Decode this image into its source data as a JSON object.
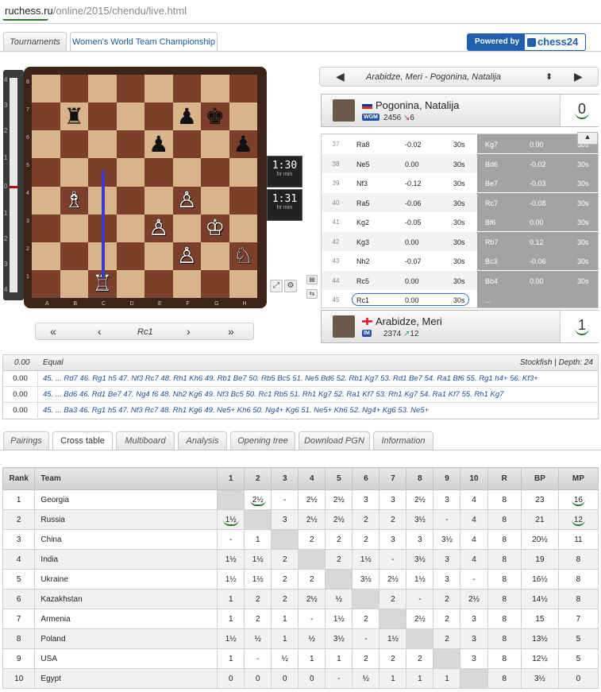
{
  "url": {
    "host": "ruchess.ru",
    "path": "/online/2015/chendu/live.html"
  },
  "top_tabs": [
    "Tournaments",
    "Women's World Team Championship"
  ],
  "powered": {
    "label": "Powered by",
    "brand": "chess24"
  },
  "eval_ticks": [
    "4",
    "3",
    "2",
    "1",
    "0",
    "1",
    "2",
    "3",
    "4"
  ],
  "board": {
    "ranks": [
      "8",
      "7",
      "6",
      "5",
      "4",
      "3",
      "2",
      "1"
    ],
    "files": [
      "A",
      "B",
      "C",
      "D",
      "E",
      "F",
      "G",
      "H"
    ],
    "squares": [
      [
        "",
        "",
        "",
        "",
        "",
        "",
        "",
        ""
      ],
      [
        "",
        "♜",
        "",
        "",
        "",
        "♟",
        "♚",
        ""
      ],
      [
        "",
        "",
        "",
        "",
        "♟",
        "",
        "",
        "♟"
      ],
      [
        "",
        "",
        "",
        "",
        "",
        "",
        "",
        ""
      ],
      [
        "",
        "♗",
        "",
        "",
        "",
        "♙",
        "",
        ""
      ],
      [
        "",
        "",
        "",
        "",
        "♙",
        "",
        "♔",
        ""
      ],
      [
        "",
        "",
        "",
        "",
        "",
        "♙",
        "",
        "♘"
      ],
      [
        "",
        "",
        "♖",
        "",
        "",
        "",
        "",
        ""
      ]
    ]
  },
  "clocks": [
    {
      "time": "1:30",
      "hr": "hr",
      "min": "min"
    },
    {
      "time": "1:31",
      "hr": "hr",
      "min": "min"
    }
  ],
  "move_nav": {
    "current": "Rc1"
  },
  "game_selector": {
    "title": "Arabidze, Meri - Pogonina, Natalija"
  },
  "player_top": {
    "name": "Pogonina, Natalija",
    "title": "WGM",
    "elo": "2456",
    "delta": "6",
    "score": "0"
  },
  "player_bottom": {
    "name": "Arabidze, Meri",
    "title": "IM",
    "elo": "2374",
    "delta": "12",
    "score": "1"
  },
  "moves": [
    {
      "n": "37",
      "w": "Ra8",
      "we": "-0.02",
      "wt": "30s",
      "b": "Kg7",
      "be": "0.00",
      "bt": "30s"
    },
    {
      "n": "38",
      "w": "Ne5",
      "we": "0.00",
      "wt": "30s",
      "b": "Bd6",
      "be": "-0.02",
      "bt": "30s"
    },
    {
      "n": "39",
      "w": "Nf3",
      "we": "-0.12",
      "wt": "30s",
      "b": "Be7",
      "be": "-0.03",
      "bt": "30s"
    },
    {
      "n": "40",
      "w": "Ra5",
      "we": "-0.06",
      "wt": "30s",
      "b": "Rc7",
      "be": "-0.08",
      "bt": "30s"
    },
    {
      "n": "41",
      "w": "Kg2",
      "we": "-0.05",
      "wt": "30s",
      "b": "Bf6",
      "be": "0.00",
      "bt": "30s"
    },
    {
      "n": "42",
      "w": "Kg3",
      "we": "0.00",
      "wt": "30s",
      "b": "Rb7",
      "be": "0.12",
      "bt": "30s"
    },
    {
      "n": "43",
      "w": "Nh2",
      "we": "-0.07",
      "wt": "30s",
      "b": "Bc3",
      "be": "-0.06",
      "bt": "30s"
    },
    {
      "n": "44",
      "w": "Rc5",
      "we": "0.00",
      "wt": "30s",
      "b": "Bb4",
      "be": "0.00",
      "bt": "30s"
    },
    {
      "n": "45",
      "w": "Rc1",
      "we": "0.00",
      "wt": "30s",
      "b": "...",
      "be": "",
      "bt": ""
    }
  ],
  "engine": {
    "eval": "0.00",
    "verdict": "Equal",
    "name": "Stockfish",
    "depth_label": "Depth: 24",
    "lines": [
      {
        "eval": "0.00",
        "pv": "45. ... Rd7 46. Rg1 h5 47. Nf3 Rc7 48. Rh1 Kh6 49. Rb1 Be7 50. Rb5 Bc5 51. Ne5 Bd6 52. Rb1 Kg7 53. Rd1 Be7 54. Ra1 Bf6 55. Rg1 h4+ 56. Kf3+"
      },
      {
        "eval": "0.00",
        "pv": "45. ... Bd6 46. Rd1 Be7 47. Ng4 f6 48. Nh2 Kg6 49. Nf3 Bc5 50. Rc1 Rb5 51. Rh1 Kg7 52. Ra1 Kf7 53. Rh1 Kg7 54. Ra1 Kf7 55. Rh1 Kg7"
      },
      {
        "eval": "0.00",
        "pv": "45. ... Ba3 46. Rg1 h5 47. Nf3 Rc7 48. Rh1 Kg6 49. Ne5+ Kh6 50. Ng4+ Kg6 51. Ne5+ Kh6 52. Ng4+ Kg6 53. Ne5+"
      }
    ]
  },
  "bottom_tabs": [
    "Pairings",
    "Cross table",
    "Multiboard",
    "Analysis",
    "Opening tree",
    "Download PGN",
    "Information"
  ],
  "cross_table": {
    "headers": [
      "Rank",
      "Team",
      "1",
      "2",
      "3",
      "4",
      "5",
      "6",
      "7",
      "8",
      "9",
      "10",
      "R",
      "BP",
      "MP"
    ],
    "rows": [
      [
        "1",
        "Georgia",
        "X",
        "2½",
        "-",
        "2½",
        "2½",
        "3",
        "3",
        "2½",
        "3",
        "4",
        "8",
        "23",
        "16"
      ],
      [
        "2",
        "Russia",
        "1½",
        "X",
        "3",
        "2½",
        "2½",
        "2",
        "2",
        "3½",
        "-",
        "4",
        "8",
        "21",
        "12"
      ],
      [
        "3",
        "China",
        "-",
        "1",
        "X",
        "2",
        "2",
        "2",
        "3",
        "3",
        "3½",
        "4",
        "8",
        "20½",
        "11"
      ],
      [
        "4",
        "India",
        "1½",
        "1½",
        "2",
        "X",
        "2",
        "1½",
        "-",
        "3½",
        "3",
        "4",
        "8",
        "19",
        "8"
      ],
      [
        "5",
        "Ukraine",
        "1½",
        "1½",
        "2",
        "2",
        "X",
        "3½",
        "2½",
        "1½",
        "3",
        "-",
        "8",
        "16½",
        "8"
      ],
      [
        "6",
        "Kazakhstan",
        "1",
        "2",
        "2",
        "2½",
        "½",
        "X",
        "2",
        "-",
        "2",
        "2½",
        "8",
        "14½",
        "8"
      ],
      [
        "7",
        "Armenia",
        "1",
        "2",
        "1",
        "-",
        "1½",
        "2",
        "X",
        "2½",
        "2",
        "3",
        "8",
        "15",
        "7"
      ],
      [
        "8",
        "Poland",
        "1½",
        "½",
        "1",
        "½",
        "3½",
        "-",
        "1½",
        "X",
        "2",
        "3",
        "8",
        "13½",
        "5"
      ],
      [
        "9",
        "USA",
        "1",
        "-",
        "½",
        "1",
        "1",
        "2",
        "2",
        "2",
        "X",
        "3",
        "8",
        "12½",
        "5"
      ],
      [
        "10",
        "Egypt",
        "0",
        "0",
        "0",
        "0",
        "-",
        "½",
        "1",
        "1",
        "1",
        "X",
        "8",
        "3½",
        "0"
      ]
    ]
  }
}
